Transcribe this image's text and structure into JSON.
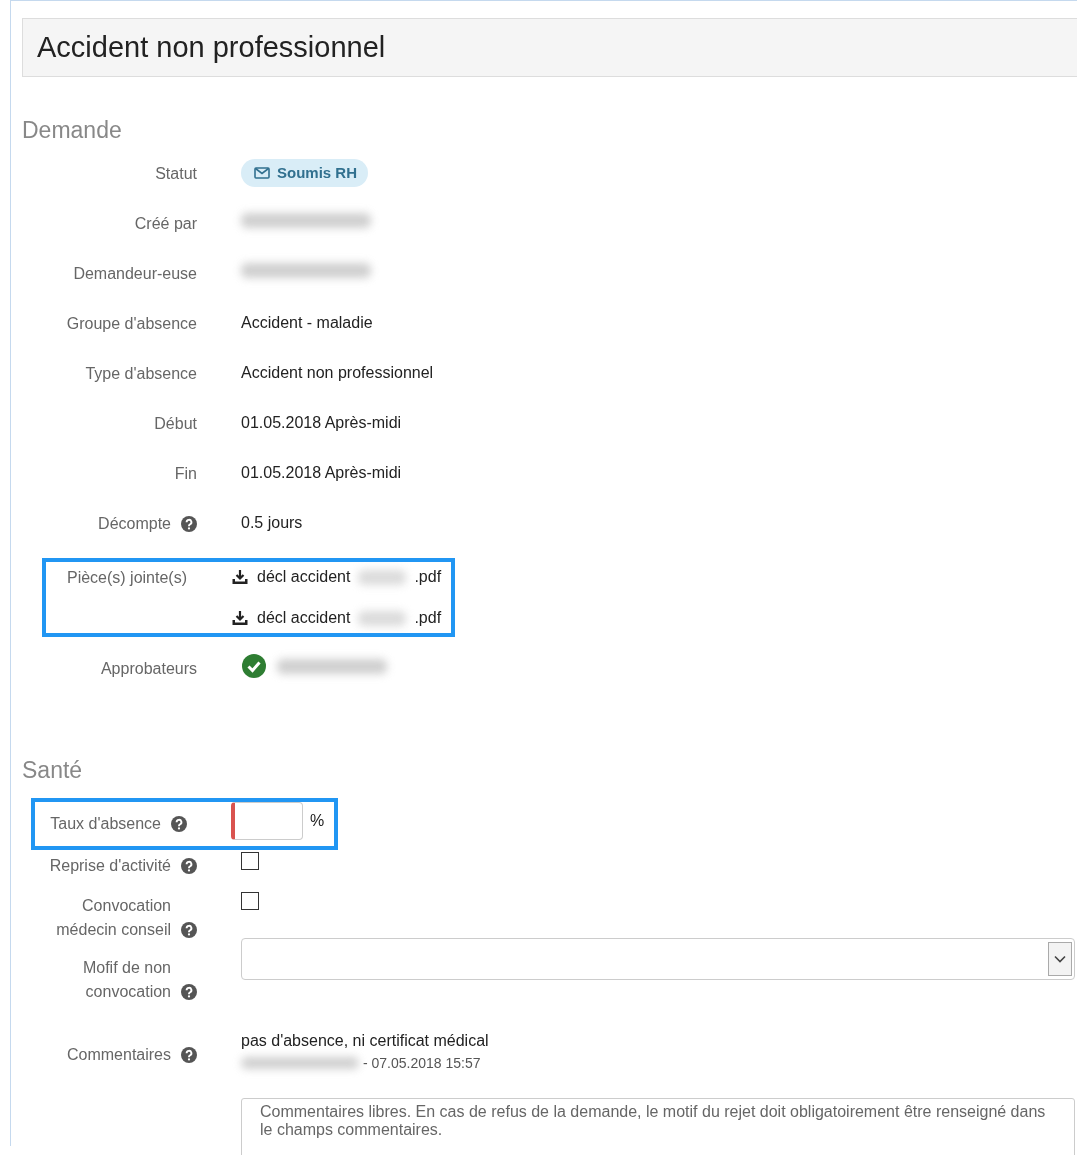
{
  "title": "Accident non professionnel",
  "sections": [
    {
      "title": "Demande",
      "fields": [
        {
          "label": "Statut",
          "kind": "badge",
          "value": "Soumis RH"
        },
        {
          "label": "Créé par",
          "kind": "redacted"
        },
        {
          "label": "Demandeur-euse",
          "kind": "redacted"
        },
        {
          "label": "Groupe d'absence",
          "kind": "text",
          "value": "Accident - maladie"
        },
        {
          "label": "Type d'absence",
          "kind": "text",
          "value": "Accident non professionnel"
        },
        {
          "label": "Début",
          "kind": "text",
          "value": "01.05.2018 Après-midi"
        },
        {
          "label": "Fin",
          "kind": "text",
          "value": "01.05.2018 Après-midi"
        },
        {
          "label": "Décompte",
          "help": true,
          "kind": "text",
          "value": "0.5 jours"
        },
        {
          "label": "Pièce(s) jointe(s)",
          "kind": "attachments",
          "highlighted": true,
          "files": [
            {
              "name": "décl accident",
              "ext": ".pdf"
            },
            {
              "name": "décl accident",
              "ext": ".pdf"
            }
          ]
        },
        {
          "label": "Approbateurs",
          "kind": "approvers",
          "approved": true
        }
      ]
    },
    {
      "title": "Santé",
      "fields": [
        {
          "label": "Taux d'absence",
          "help": true,
          "kind": "percent",
          "highlighted": true,
          "invalid": true,
          "unit": "%"
        },
        {
          "label": "Reprise d'activité",
          "help": true,
          "kind": "checkbox",
          "checked": false
        },
        {
          "label": "Convocation médecin conseil",
          "help": true,
          "kind": "checkbox",
          "checked": false
        },
        {
          "label": "Mofif de non convocation",
          "help": true,
          "kind": "select"
        },
        {
          "label": "Commentaires",
          "help": true,
          "kind": "comments",
          "comment": "pas d'absence, ni certificat médical",
          "date": "- 07.05.2018 15:57",
          "placeholder": "Commentaires libres. En cas de refus de la demande, le motif du rejet doit obligatoirement être renseigné dans le champs commentaires."
        }
      ]
    }
  ]
}
